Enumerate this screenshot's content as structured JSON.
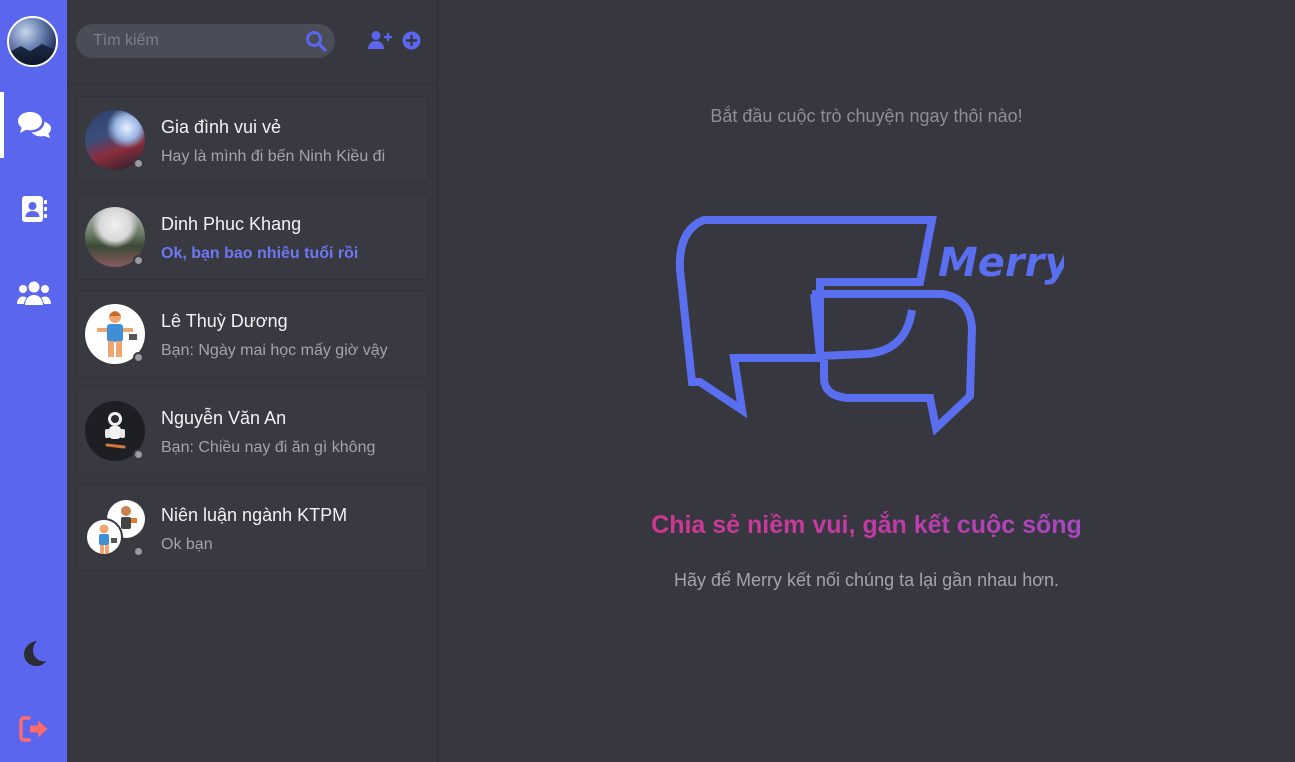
{
  "colors": {
    "accent": "#5a66ee",
    "background": "#36373f",
    "unread_text": "#6d78f3",
    "logout": "#ff6b6b",
    "tagline_start": "#e0337a",
    "tagline_end": "#8e55e0"
  },
  "rail": {
    "avatar_icon": "user-avatar",
    "items": [
      {
        "icon": "chat-bubbles-icon",
        "active": true
      },
      {
        "icon": "contacts-book-icon",
        "active": false
      },
      {
        "icon": "group-icon",
        "active": false
      }
    ],
    "bottom": [
      {
        "icon": "moon-icon"
      },
      {
        "icon": "logout-icon"
      }
    ]
  },
  "search": {
    "placeholder": "Tìm kiếm"
  },
  "header_actions": [
    "add-friend-icon",
    "add-group-icon"
  ],
  "conversations": [
    {
      "name": "Gia đình vui vẻ",
      "last_message": "Hay là mình đi bến Ninh Kiều đi",
      "unread": false
    },
    {
      "name": "Dinh Phuc Khang",
      "last_message": "Ok, bạn bao nhiêu tuổi rồi",
      "unread": true
    },
    {
      "name": "Lê Thuỳ Dương",
      "last_message": "Bạn: Ngày mai học mấy giờ vậy",
      "unread": false
    },
    {
      "name": "Nguyễn Văn An",
      "last_message": "Bạn: Chiều nay đi ăn gì không",
      "unread": false
    },
    {
      "name": "Niên luận ngành KTPM",
      "last_message": "Ok bạn",
      "unread": false
    }
  ],
  "main": {
    "hint": "Bắt đầu cuộc trò chuyện ngay thôi nào!",
    "logo_text": "Merry",
    "tagline": "Chia sẻ niềm vui, gắn kết cuộc sống",
    "subtitle": "Hãy để Merry kết nối chúng ta lại gần nhau hơn."
  }
}
